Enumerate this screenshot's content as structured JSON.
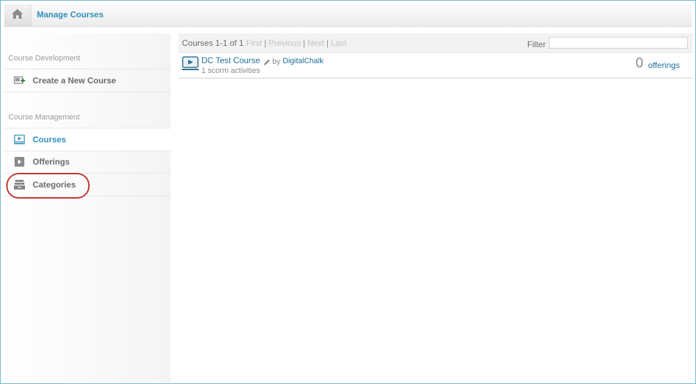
{
  "header": {
    "title": "Manage Courses",
    "home_icon": "home-icon"
  },
  "sidebar": {
    "sections": [
      {
        "label": "Course Development",
        "items": [
          {
            "label": "Create a New Course",
            "icon": "add-course-icon",
            "active": false
          }
        ]
      },
      {
        "label": "Course Management",
        "items": [
          {
            "label": "Courses",
            "icon": "course-screen-icon",
            "active": true
          },
          {
            "label": "Offerings",
            "icon": "play-icon",
            "active": false
          },
          {
            "label": "Categories",
            "icon": "categories-icon",
            "active": false,
            "highlighted": true
          }
        ]
      }
    ]
  },
  "pager": {
    "summary": "Courses 1-1 of 1",
    "first": "First",
    "previous": "Previous",
    "next": "Next",
    "last": "Last",
    "separator": "|"
  },
  "filter": {
    "label": "Filter",
    "value": "",
    "placeholder": ""
  },
  "courses": [
    {
      "name": "DC Test Course",
      "by_label": "by",
      "author": "DigitalChalk",
      "activities": "1 scorm activities",
      "offerings_count": "0",
      "offerings_label": "offerings"
    }
  ],
  "colors": {
    "accent": "#2e8fbd",
    "link": "#1f6f99",
    "highlight_ring": "#c0322f",
    "frame_border": "#6fb3d2"
  }
}
